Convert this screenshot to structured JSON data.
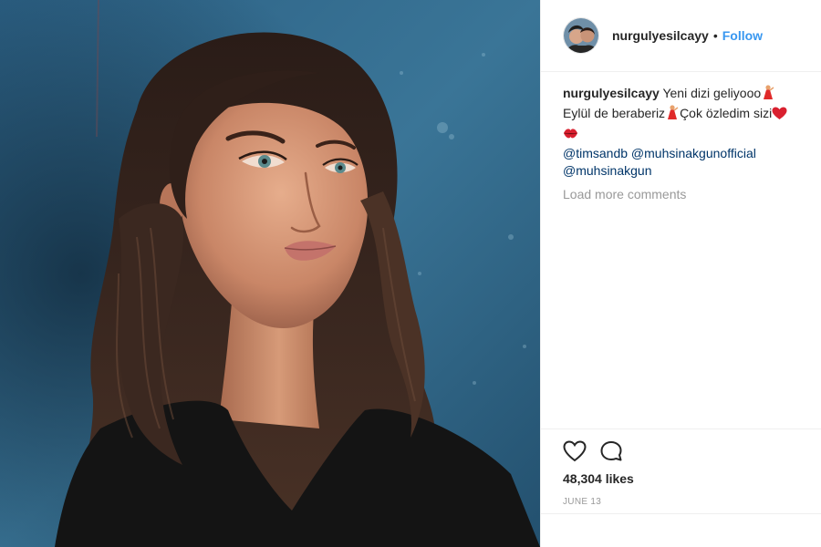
{
  "header": {
    "username": "nurgulyesilcayy",
    "separator": "•",
    "follow_label": "Follow",
    "avatar_icon": "profile-photo"
  },
  "caption": {
    "username": "nurgulyesilcayy",
    "text_1": "Yeni dizi geliyooo",
    "text_2": "Eylül de beraberiz",
    "text_3": "Çok özledim sizi",
    "emoji_1": "dancer-emoji",
    "emoji_2": "heart-emoji",
    "emoji_3": "kiss-emoji",
    "mentions": [
      "@timsandb",
      "@muhsinakgunofficial",
      "@muhsinakgun"
    ]
  },
  "load_more_label": "Load more comments",
  "actions": {
    "like_icon": "heart-outline-icon",
    "comment_icon": "comment-bubble-icon"
  },
  "likes_label": "48,304 likes",
  "date_label": "JUNE 13",
  "colors": {
    "link": "#3897f0",
    "mention": "#003569",
    "muted": "#999999",
    "text": "#262626",
    "wall": "#2d5f7f"
  }
}
